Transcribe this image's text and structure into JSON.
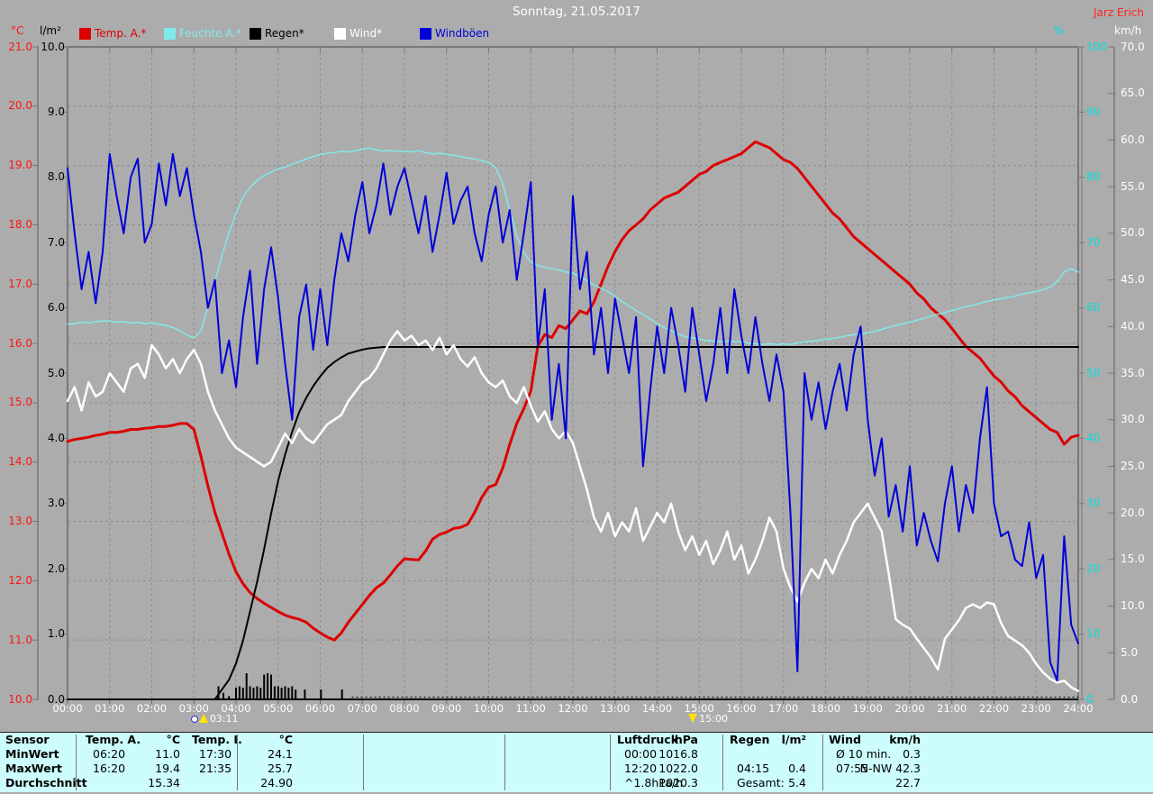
{
  "window": {
    "title": "Sonntag, 21.05.2017",
    "author": "Jarz Erich"
  },
  "chart_data": {
    "type": "line",
    "title": "Sonntag, 21.05.2017",
    "grid": true,
    "legend_position": "top",
    "x_axis": {
      "unit": "time",
      "tick_labels": [
        "00:00",
        "01:00",
        "02:00",
        "03:00",
        "04:00",
        "05:00",
        "06:00",
        "07:00",
        "08:00",
        "09:00",
        "10:00",
        "11:00",
        "12:00",
        "13:00",
        "14:00",
        "15:00",
        "16:00",
        "17:00",
        "18:00",
        "19:00",
        "20:00",
        "21:00",
        "22:00",
        "23:00",
        "24:00"
      ]
    },
    "axes": [
      {
        "id": "temp",
        "unit": "°C",
        "color": "#ff1515",
        "min": 10,
        "max": 21,
        "tick_labels": [
          "21.0",
          "20.0",
          "19.0",
          "18.0",
          "17.0",
          "16.0",
          "15.0",
          "14.0",
          "13.0",
          "12.0",
          "11.0",
          "10.0"
        ]
      },
      {
        "id": "rain",
        "unit": "l/m²",
        "color": "#000000",
        "min": 0,
        "max": 10,
        "tick_labels": [
          "10.0",
          "9.0",
          "8.0",
          "7.0",
          "6.0",
          "5.0",
          "4.0",
          "3.0",
          "2.0",
          "1.0",
          "0.0"
        ]
      },
      {
        "id": "humidity",
        "unit": "%",
        "color": "#00e0e0",
        "min": 0,
        "max": 100,
        "tick_labels": [
          "100",
          "90",
          "80",
          "70",
          "60",
          "50",
          "40",
          "30",
          "20",
          "10",
          "0"
        ]
      },
      {
        "id": "wind",
        "unit": "km/h",
        "color": "#ffffff",
        "min": 0,
        "max": 70,
        "tick_labels": [
          "70.0",
          "65.0",
          "60.0",
          "55.0",
          "50.0",
          "45.0",
          "40.0",
          "35.0",
          "30.0",
          "25.0",
          "20.0",
          "15.0",
          "10.0",
          "5.0",
          "0.0"
        ]
      }
    ],
    "series": [
      {
        "name": "Temp. A.*",
        "axis": "temp",
        "color": "#dd0000",
        "width": 3,
        "step_min": 10,
        "values": [
          14.35,
          14.38,
          14.4,
          14.42,
          14.45,
          14.47,
          14.5,
          14.5,
          14.52,
          14.55,
          14.55,
          14.57,
          14.58,
          14.6,
          14.6,
          14.62,
          14.65,
          14.65,
          14.55,
          14.1,
          13.6,
          13.15,
          12.8,
          12.45,
          12.15,
          11.95,
          11.8,
          11.7,
          11.62,
          11.55,
          11.48,
          11.42,
          11.38,
          11.35,
          11.3,
          11.2,
          11.12,
          11.05,
          11.0,
          11.12,
          11.3,
          11.45,
          11.6,
          11.75,
          11.88,
          11.96,
          12.1,
          12.25,
          12.37,
          12.36,
          12.35,
          12.5,
          12.7,
          12.78,
          12.82,
          12.88,
          12.9,
          12.95,
          13.15,
          13.4,
          13.58,
          13.62,
          13.9,
          14.3,
          14.65,
          14.9,
          15.2,
          15.95,
          16.15,
          16.1,
          16.3,
          16.25,
          16.4,
          16.55,
          16.5,
          16.7,
          17.0,
          17.3,
          17.55,
          17.75,
          17.9,
          18.0,
          18.1,
          18.25,
          18.35,
          18.45,
          18.5,
          18.55,
          18.65,
          18.75,
          18.85,
          18.9,
          19.0,
          19.05,
          19.1,
          19.15,
          19.2,
          19.3,
          19.4,
          19.35,
          19.3,
          19.2,
          19.1,
          19.05,
          18.95,
          18.8,
          18.65,
          18.5,
          18.35,
          18.2,
          18.1,
          17.95,
          17.8,
          17.7,
          17.6,
          17.5,
          17.4,
          17.3,
          17.2,
          17.1,
          17.0,
          16.85,
          16.75,
          16.6,
          16.5,
          16.4,
          16.25,
          16.1,
          15.95,
          15.85,
          15.75,
          15.6,
          15.45,
          15.35,
          15.2,
          15.1,
          14.95,
          14.85,
          14.75,
          14.65,
          14.55,
          14.5,
          14.3,
          14.42,
          14.45
        ]
      },
      {
        "name": "Feuchte A.*",
        "axis": "humidity",
        "color": "#82e9e9",
        "width": 1.5,
        "step_min": 10,
        "values": [
          57.5,
          57.6,
          57.8,
          57.7,
          57.9,
          58.0,
          58.0,
          57.8,
          57.9,
          57.7,
          57.8,
          57.6,
          57.7,
          57.5,
          57.3,
          57.0,
          56.5,
          55.8,
          55.4,
          56.5,
          60.0,
          64.0,
          68.0,
          71.5,
          74.5,
          77.0,
          78.5,
          79.5,
          80.3,
          80.8,
          81.3,
          81.6,
          82.0,
          82.4,
          82.8,
          83.2,
          83.5,
          83.7,
          83.8,
          84.0,
          83.9,
          84.1,
          84.3,
          84.5,
          84.2,
          84.0,
          84.1,
          84.0,
          84.0,
          83.9,
          84.1,
          83.8,
          83.6,
          83.7,
          83.5,
          83.4,
          83.2,
          83.0,
          82.8,
          82.6,
          82.3,
          81.5,
          79.0,
          75.0,
          71.0,
          68.5,
          67.0,
          66.5,
          66.2,
          66.0,
          65.8,
          65.5,
          65.3,
          64.8,
          64.2,
          63.5,
          63.0,
          62.5,
          61.8,
          61.0,
          60.3,
          59.6,
          59.0,
          58.3,
          57.6,
          57.0,
          56.5,
          56.0,
          55.6,
          55.4,
          55.2,
          55.0,
          54.9,
          54.8,
          54.9,
          54.8,
          54.8,
          54.6,
          54.5,
          54.4,
          54.5,
          54.4,
          54.5,
          54.4,
          54.6,
          54.8,
          54.9,
          55.0,
          55.2,
          55.3,
          55.5,
          55.7,
          55.9,
          56.0,
          56.2,
          56.4,
          56.7,
          57.0,
          57.3,
          57.6,
          57.8,
          58.1,
          58.4,
          58.7,
          59.0,
          59.3,
          59.6,
          59.9,
          60.2,
          60.4,
          60.7,
          61.0,
          61.2,
          61.4,
          61.6,
          61.8,
          62.1,
          62.3,
          62.5,
          62.8,
          63.2,
          64.0,
          65.5,
          66.0,
          65.5
        ]
      },
      {
        "name": "Regen*",
        "axis": "rain",
        "color": "#000000",
        "width": 2,
        "step_min": 10,
        "values": [
          0,
          0,
          0,
          0,
          0,
          0,
          0,
          0,
          0,
          0,
          0,
          0,
          0,
          0,
          0,
          0,
          0,
          0,
          0,
          0,
          0,
          0,
          0.15,
          0.3,
          0.55,
          0.9,
          1.35,
          1.8,
          2.3,
          2.85,
          3.35,
          3.75,
          4.1,
          4.4,
          4.62,
          4.8,
          4.95,
          5.08,
          5.17,
          5.24,
          5.3,
          5.33,
          5.36,
          5.38,
          5.39,
          5.4,
          5.4,
          5.4,
          5.4,
          5.4,
          5.4,
          5.4,
          5.4,
          5.4,
          5.4,
          5.4,
          5.4,
          5.4,
          5.4,
          5.4,
          5.4,
          5.4,
          5.4,
          5.4,
          5.4,
          5.4,
          5.4,
          5.4,
          5.4,
          5.4,
          5.4,
          5.4,
          5.4,
          5.4,
          5.4,
          5.4,
          5.4,
          5.4,
          5.4,
          5.4,
          5.4,
          5.4,
          5.4,
          5.4,
          5.4,
          5.4,
          5.4,
          5.4,
          5.4,
          5.4,
          5.4,
          5.4,
          5.4,
          5.4,
          5.4,
          5.4,
          5.4,
          5.4,
          5.4,
          5.4,
          5.4,
          5.4,
          5.4,
          5.4,
          5.4,
          5.4,
          5.4,
          5.4,
          5.4,
          5.4,
          5.4,
          5.4,
          5.4,
          5.4,
          5.4,
          5.4,
          5.4,
          5.4,
          5.4,
          5.4,
          5.4,
          5.4,
          5.4,
          5.4,
          5.4,
          5.4,
          5.4,
          5.4,
          5.4,
          5.4,
          5.4,
          5.4,
          5.4,
          5.4,
          5.4,
          5.4,
          5.4,
          5.4,
          5.4,
          5.4,
          5.4,
          5.4,
          5.4,
          5.4,
          5.4
        ]
      },
      {
        "name": "Wind*",
        "axis": "wind",
        "color": "#ffffff",
        "width": 2.5,
        "step_min": 10,
        "values": [
          32.0,
          33.5,
          31.0,
          34.0,
          32.5,
          33.0,
          35.0,
          34.0,
          33.0,
          35.5,
          36.0,
          34.5,
          38.0,
          37.0,
          35.5,
          36.5,
          35.0,
          36.5,
          37.5,
          36.0,
          33.0,
          31.0,
          29.5,
          28.0,
          27.0,
          26.5,
          26.0,
          25.5,
          25.0,
          25.5,
          27.0,
          28.5,
          27.5,
          29.0,
          28.0,
          27.5,
          28.5,
          29.5,
          30.0,
          30.5,
          32.0,
          33.0,
          34.0,
          34.5,
          35.5,
          37.0,
          38.5,
          39.5,
          38.5,
          39.0,
          38.0,
          38.5,
          37.5,
          38.8,
          37.0,
          38.0,
          36.5,
          35.7,
          36.7,
          35.0,
          34.0,
          33.5,
          34.2,
          32.5,
          31.8,
          33.5,
          31.5,
          29.8,
          30.9,
          29.0,
          28.0,
          28.8,
          27.5,
          25.0,
          22.5,
          19.5,
          18.0,
          20.0,
          17.5,
          19.0,
          18.0,
          20.5,
          17.0,
          18.5,
          20.0,
          19.0,
          21.0,
          18.0,
          16.0,
          17.5,
          15.5,
          17.0,
          14.5,
          16.0,
          18.0,
          15.0,
          16.5,
          13.5,
          15.0,
          17.0,
          19.5,
          18.0,
          14.0,
          12.0,
          10.5,
          12.5,
          14.0,
          13.0,
          15.0,
          13.5,
          15.5,
          17.0,
          19.0,
          20.0,
          21.0,
          19.5,
          18.0,
          13.5,
          8.6,
          8.0,
          7.6,
          6.5,
          5.5,
          4.5,
          3.2,
          6.5,
          7.5,
          8.5,
          9.8,
          10.2,
          9.8,
          10.4,
          10.2,
          8.2,
          6.8,
          6.3,
          5.8,
          5.0,
          3.8,
          2.9,
          2.2,
          1.8,
          2.0,
          1.3,
          0.9
        ]
      },
      {
        "name": "Windböen",
        "axis": "wind",
        "color": "#0000d8",
        "width": 2,
        "step_min": 10,
        "values": [
          57.0,
          50.0,
          44.0,
          48.0,
          42.5,
          48.0,
          58.5,
          54.0,
          50.0,
          56.0,
          58.0,
          49.0,
          51.0,
          57.5,
          53.0,
          58.5,
          54.0,
          57.0,
          52.0,
          48.0,
          42.0,
          45.0,
          35.0,
          38.5,
          33.5,
          41.0,
          46.0,
          36.0,
          44.0,
          48.5,
          43.0,
          36.0,
          30.0,
          41.0,
          44.5,
          37.5,
          44.0,
          38.0,
          45.0,
          50.0,
          47.0,
          52.0,
          55.5,
          50.0,
          53.0,
          57.5,
          52.0,
          55.0,
          57.0,
          53.5,
          50.0,
          54.0,
          48.0,
          52.0,
          56.5,
          51.0,
          53.5,
          55.0,
          50.0,
          47.0,
          52.0,
          55.0,
          49.0,
          52.5,
          45.0,
          50.0,
          55.5,
          38.0,
          44.0,
          30.0,
          36.0,
          28.0,
          54.0,
          44.0,
          48.0,
          37.0,
          42.0,
          35.0,
          43.0,
          39.0,
          35.0,
          41.0,
          25.0,
          33.0,
          40.0,
          35.0,
          42.0,
          38.0,
          33.0,
          42.0,
          37.0,
          32.0,
          36.0,
          42.0,
          35.0,
          44.0,
          39.0,
          35.0,
          41.0,
          36.0,
          32.0,
          37.0,
          33.0,
          20.0,
          3.0,
          35.0,
          30.0,
          34.0,
          29.0,
          33.0,
          36.0,
          31.0,
          37.0,
          40.0,
          30.0,
          24.0,
          28.0,
          19.6,
          23.0,
          18.0,
          25.0,
          16.5,
          20.0,
          17.0,
          14.8,
          21.0,
          25.0,
          18.0,
          23.0,
          20.0,
          28.0,
          33.5,
          21.0,
          17.5,
          18.0,
          15.0,
          14.3,
          19.0,
          13.0,
          15.5,
          4.0,
          2.0,
          17.5,
          8.0,
          6.0
        ]
      }
    ],
    "rain_bars": {
      "axis": "rain",
      "color": "#000000",
      "points": [
        [
          215,
          0.2
        ],
        [
          222,
          0.1
        ],
        [
          230,
          0.05
        ],
        [
          240,
          0.18
        ],
        [
          245,
          0.2
        ],
        [
          250,
          0.18
        ],
        [
          255,
          0.4
        ],
        [
          260,
          0.2
        ],
        [
          265,
          0.18
        ],
        [
          270,
          0.2
        ],
        [
          275,
          0.18
        ],
        [
          280,
          0.38
        ],
        [
          285,
          0.4
        ],
        [
          290,
          0.38
        ],
        [
          295,
          0.2
        ],
        [
          300,
          0.2
        ],
        [
          305,
          0.18
        ],
        [
          310,
          0.2
        ],
        [
          315,
          0.18
        ],
        [
          320,
          0.2
        ],
        [
          325,
          0.15
        ],
        [
          338,
          0.15
        ],
        [
          361,
          0.15
        ],
        [
          391,
          0.15
        ]
      ]
    },
    "markers": [
      {
        "label": "03:11",
        "minutes": 191,
        "icon": "sunrise"
      },
      {
        "label": "15:00",
        "minutes": 900,
        "icon": "sunset"
      }
    ]
  },
  "table": {
    "row_headers": [
      "Sensor",
      "MinWert",
      "MaxWert",
      "Durchschnitt"
    ],
    "columns": [
      {
        "header": "Temp. A.",
        "unit": "°C",
        "rows": [
          [
            "06:20",
            "11.0"
          ],
          [
            "16:20",
            "19.4"
          ],
          [
            "",
            "15.34"
          ]
        ]
      },
      {
        "header": "Temp. I.",
        "unit": "°C",
        "rows": [
          [
            "17:30",
            "24.1"
          ],
          [
            "21:35",
            "25.7"
          ],
          [
            "",
            "24.90"
          ]
        ]
      },
      {
        "header": "",
        "unit": "",
        "rows": [
          [
            "",
            ""
          ],
          [
            "",
            ""
          ],
          [
            "",
            ""
          ]
        ]
      },
      {
        "header": "",
        "unit": "",
        "rows": [
          [
            "",
            ""
          ],
          [
            "",
            ""
          ],
          [
            "",
            ""
          ]
        ]
      },
      {
        "header": "Luftdruck",
        "unit": "hPa",
        "rows": [
          [
            "00:00",
            "1016.8"
          ],
          [
            "12:20",
            "1022.0"
          ],
          [
            "^1.8hPa/h",
            "1020.3"
          ]
        ]
      },
      {
        "header": "Regen",
        "unit": "l/m²",
        "rows": [
          [
            "",
            ""
          ],
          [
            "04:15",
            "0.4"
          ],
          [
            "Gesamt:",
            "5.4"
          ]
        ]
      },
      {
        "header": "Wind",
        "unit": "km/h",
        "rows": [
          [
            "Ø 10 min.",
            "0.3"
          ],
          [
            "07:55",
            "N-NW 42.3"
          ],
          [
            "",
            "22.7"
          ]
        ]
      }
    ]
  },
  "colors": {
    "background": "#acacac",
    "grid": "#8e8e8e",
    "axis_line": "#787878",
    "table_background": "#ccfcfc",
    "title_text": "#ffffff",
    "author_text": "#ff2222",
    "marker_yellow": "#ffe400"
  }
}
